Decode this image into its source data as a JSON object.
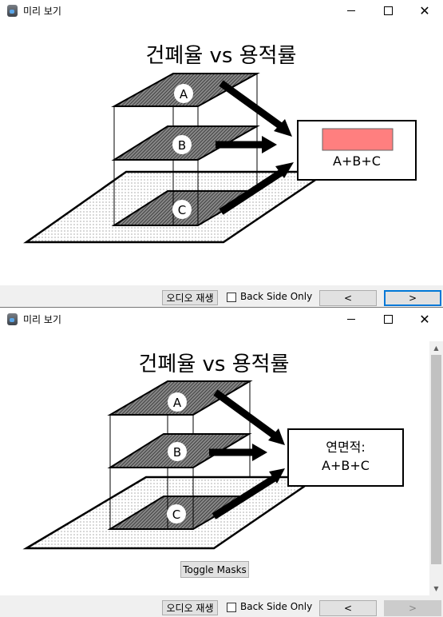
{
  "windows": [
    {
      "title": "미리 보기",
      "diagram": {
        "title": "건폐율 vs 용적률",
        "floors": [
          "A",
          "B",
          "C"
        ],
        "result_label": "A+B+C",
        "result_prefix": "",
        "highlight_color": "#ff7f7f",
        "masked": true
      },
      "bottom": {
        "audio_label": "오디오 재생",
        "back_side_label": "Back Side Only",
        "back_side_checked": false,
        "prev_label": "<",
        "next_label": ">",
        "next_focused": true
      }
    },
    {
      "title": "미리 보기",
      "diagram": {
        "title": "건폐율 vs 용적률",
        "floors": [
          "A",
          "B",
          "C"
        ],
        "result_prefix": "연면적:",
        "result_label": "A+B+C",
        "masked": false
      },
      "toggle_label": "Toggle Masks",
      "bottom": {
        "audio_label": "오디오 재생",
        "back_side_label": "Back Side Only",
        "back_side_checked": false,
        "prev_label": "<",
        "next_label": ">",
        "next_disabled": true
      }
    }
  ],
  "icons": {
    "minimize": "─",
    "maximize": "☐",
    "close": "✕",
    "scroll_up": "▲",
    "scroll_down": "▼"
  }
}
